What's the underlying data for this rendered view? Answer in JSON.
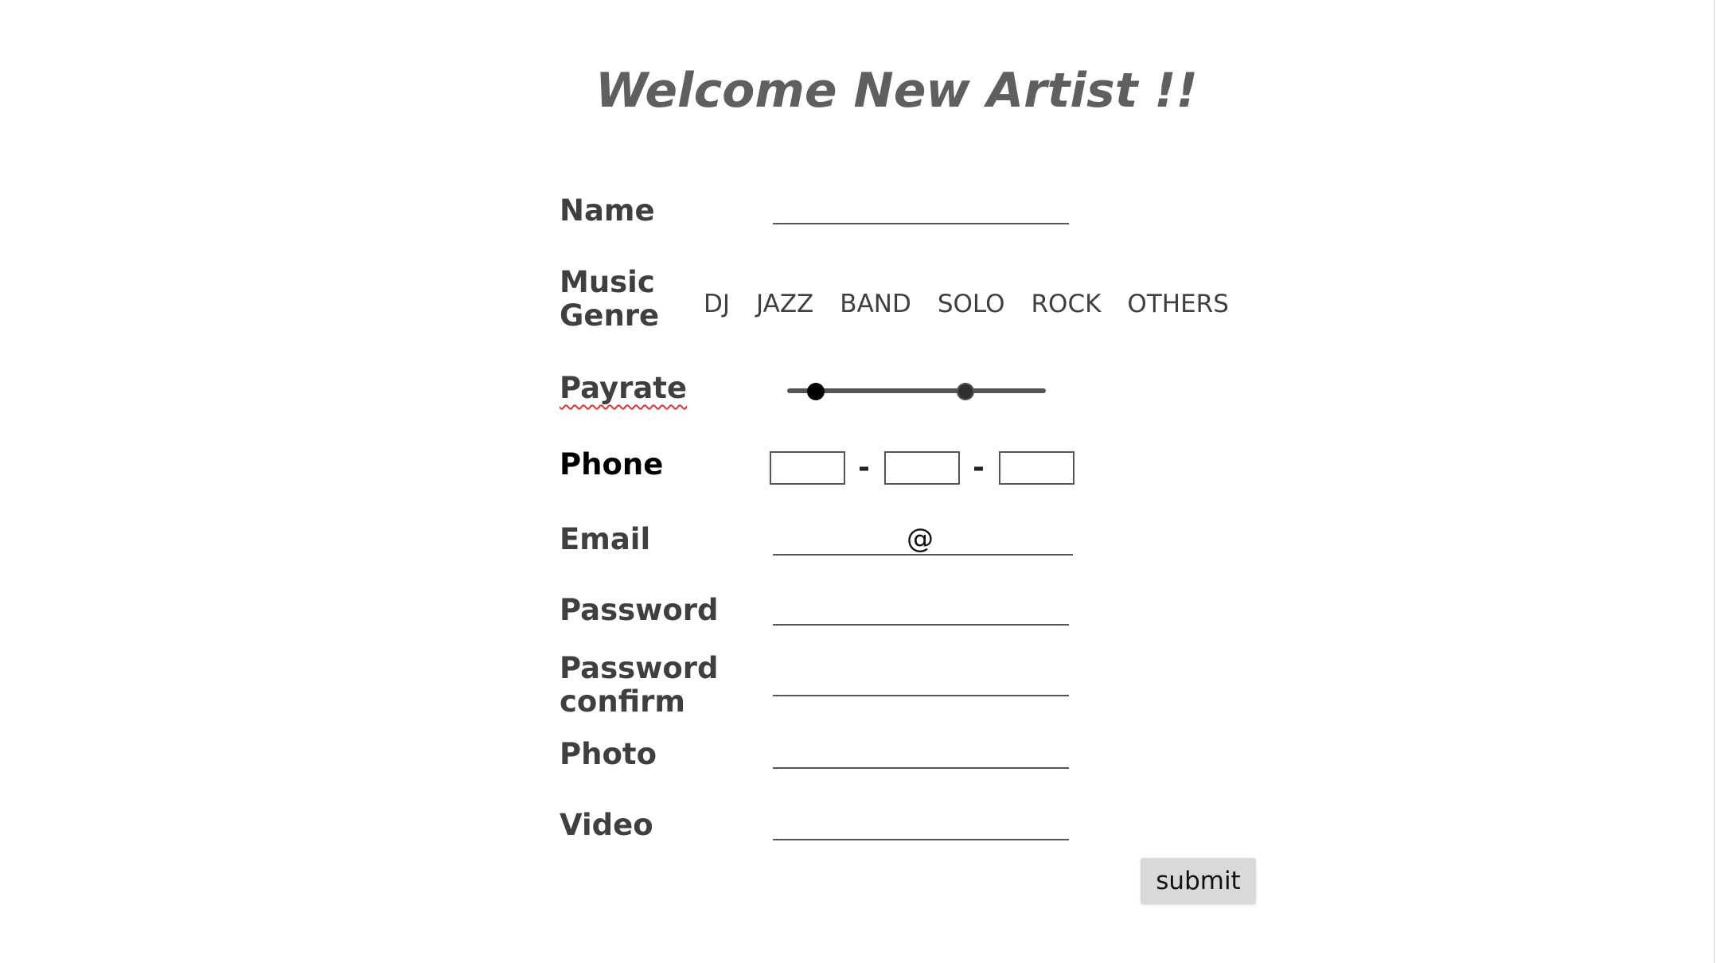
{
  "page": {
    "title": "Welcome New Artist !!"
  },
  "form": {
    "name": {
      "label": "Name",
      "value": ""
    },
    "genre": {
      "label": "Music Genre",
      "options": [
        "DJ",
        "JAZZ",
        "BAND",
        "SOLO",
        "ROCK",
        "OTHERS"
      ]
    },
    "payrate": {
      "label": "Payrate",
      "range_low_fraction": 0.11,
      "range_high_fraction": 0.69
    },
    "phone": {
      "label": "Phone",
      "separator": "-",
      "parts": [
        "",
        "",
        ""
      ]
    },
    "email": {
      "label": "Email",
      "at_symbol": "@",
      "user_value": "",
      "domain_value": ""
    },
    "password": {
      "label": "Password",
      "value": ""
    },
    "password_confirm": {
      "label": "Password confirm",
      "value": ""
    },
    "photo": {
      "label": "Photo",
      "value": ""
    },
    "video": {
      "label": "Video",
      "value": ""
    },
    "submit_label": "submit"
  },
  "colors": {
    "title": "#5f5f5f",
    "label": "#3f3f3f",
    "line": "#555555",
    "button_bg": "#d9d9d9",
    "spellcheck": "#e03030"
  }
}
